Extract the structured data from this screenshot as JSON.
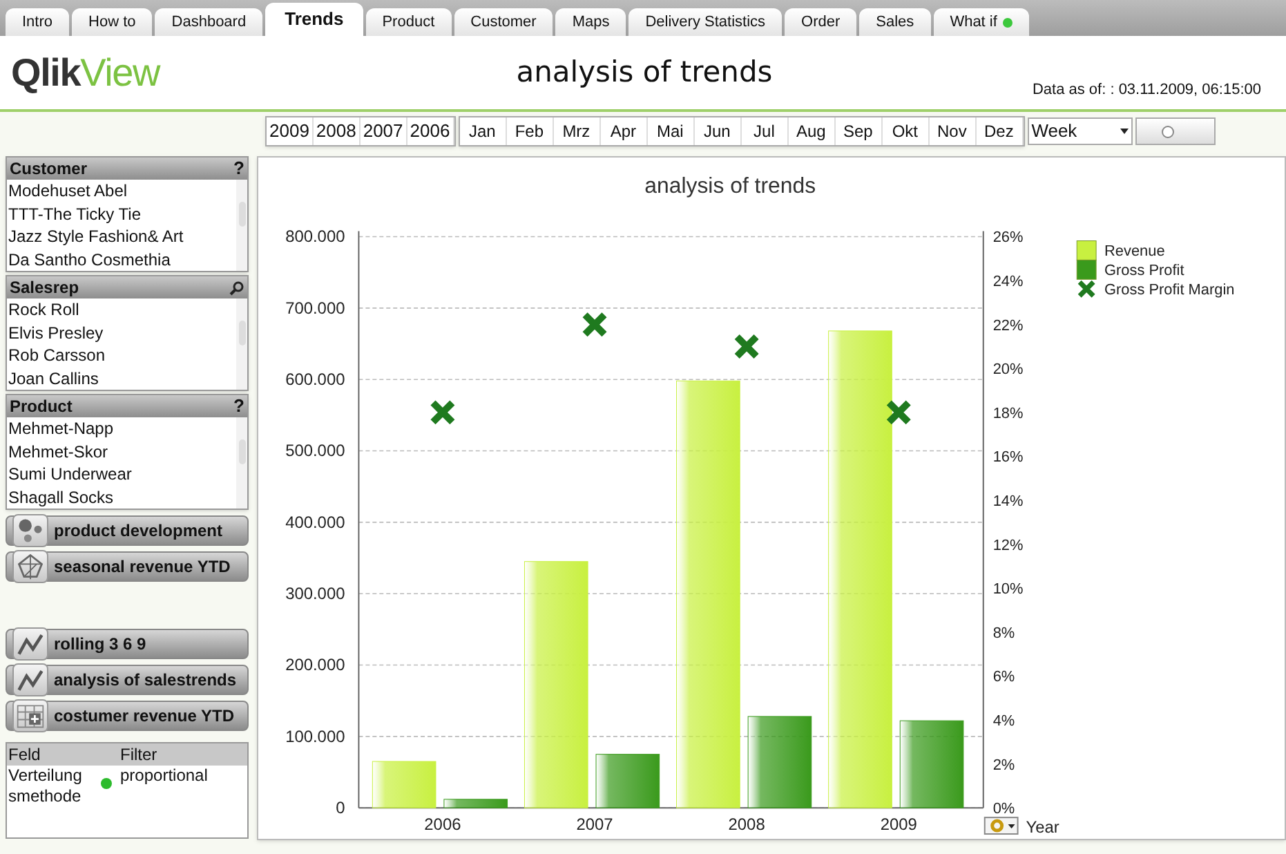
{
  "tabs": [
    {
      "label": "Intro",
      "selected": false
    },
    {
      "label": "How to",
      "selected": false
    },
    {
      "label": "Dashboard",
      "selected": false
    },
    {
      "label": "Trends",
      "selected": true
    },
    {
      "label": "Product",
      "selected": false
    },
    {
      "label": "Customer",
      "selected": false
    },
    {
      "label": "Maps",
      "selected": false
    },
    {
      "label": "Delivery Statistics",
      "selected": false
    },
    {
      "label": "Order",
      "selected": false
    },
    {
      "label": "Sales",
      "selected": false
    },
    {
      "label": "What if",
      "selected": false,
      "status_dot": true
    }
  ],
  "header": {
    "logo_left": "Qlik",
    "logo_right": "View",
    "title": "analysis of trends",
    "data_as_of": "Data as of: : 03.11.2009, 06:15:00"
  },
  "filters": {
    "years": [
      {
        "label": "2009",
        "selected": false
      },
      {
        "label": "2008",
        "selected": false
      },
      {
        "label": "2007",
        "selected": false
      },
      {
        "label": "2006",
        "selected": false
      }
    ],
    "months": [
      {
        "label": "Jan",
        "selected": false
      },
      {
        "label": "Feb",
        "selected": false
      },
      {
        "label": "Mrz",
        "selected": false
      },
      {
        "label": "Apr",
        "selected": false
      },
      {
        "label": "Mai",
        "selected": false
      },
      {
        "label": "Jun",
        "selected": false
      },
      {
        "label": "Jul",
        "selected": false
      },
      {
        "label": "Aug",
        "selected": false
      },
      {
        "label": "Sep",
        "selected": false
      },
      {
        "label": "Okt",
        "selected": false
      },
      {
        "label": "Nov",
        "selected": false
      },
      {
        "label": "Dez",
        "selected": false
      }
    ],
    "period": "Week",
    "slider": {
      "level": 0.4
    }
  },
  "listboxes": [
    {
      "title": "Customer",
      "kind": "help",
      "help": "?",
      "items": [
        {
          "label": "Modehuset Abel",
          "selected": false
        },
        {
          "label": "TTT-The Ticky Tie",
          "selected": false
        },
        {
          "label": "Jazz Style Fashion& Art",
          "selected": false
        },
        {
          "label": "Da Santho Cosmethia",
          "selected": false
        }
      ]
    },
    {
      "title": "Salesrep",
      "kind": "search",
      "items": [
        {
          "label": "Rock Roll",
          "selected": false
        },
        {
          "label": "Elvis Presley",
          "selected": false
        },
        {
          "label": "Rob Carsson",
          "selected": false
        },
        {
          "label": "Joan Callins",
          "selected": false
        }
      ]
    },
    {
      "title": "Product",
      "kind": "help",
      "help": "?",
      "items": [
        {
          "label": "Mehmet-Napp",
          "selected": false
        },
        {
          "label": "Mehmet-Skor",
          "selected": false
        },
        {
          "label": "Sumi Underwear",
          "selected": false
        },
        {
          "label": "Shagall Socks",
          "selected": false
        }
      ]
    }
  ],
  "nav_buttons": [
    {
      "label": "product development",
      "kind": "dots"
    },
    {
      "label": "seasonal revenue YTD",
      "kind": "radar"
    },
    {
      "label": "rolling 3 6 9",
      "kind": "line",
      "gap": true
    },
    {
      "label": "analysis of salestrends",
      "kind": "line"
    },
    {
      "label": "costumer revenue YTD",
      "kind": "table"
    }
  ],
  "filter_table": {
    "columns": [
      "Feld",
      "Filter"
    ],
    "rows": [
      {
        "field": "Verteilungsmethode",
        "filter": "proportional",
        "active": true
      }
    ]
  },
  "chart": {
    "chart_data": {
      "type": "bar",
      "stacked": false,
      "grid": true,
      "legend": "upper right",
      "title": "analysis of trends",
      "xlabel": "Year",
      "categories": [
        "2006",
        "2007",
        "2008",
        "2009"
      ],
      "series": [
        {
          "name": "Revenue",
          "color": "#c8f040",
          "values": [
            65000,
            345000,
            598000,
            668000
          ]
        },
        {
          "name": "Gross Profit",
          "color": "#3a9a1c",
          "values": [
            12000,
            75000,
            128000,
            122000
          ]
        },
        {
          "name": "Gross Profit Margin",
          "type": "scatter",
          "color": "#1f7a1f",
          "axis": "y2",
          "values": [
            0.18,
            0.22,
            0.21,
            0.18
          ]
        }
      ],
      "ylim": [
        0,
        800000
      ],
      "yticks": [
        {
          "value": 0,
          "label": "0"
        },
        {
          "value": 100000,
          "label": "100.000"
        },
        {
          "value": 200000,
          "label": "200.000"
        },
        {
          "value": 300000,
          "label": "300.000"
        },
        {
          "value": 400000,
          "label": "400.000"
        },
        {
          "value": 500000,
          "label": "500.000"
        },
        {
          "value": 600000,
          "label": "600.000"
        },
        {
          "value": 700000,
          "label": "700.000"
        },
        {
          "value": 800000,
          "label": "800.000"
        }
      ],
      "y2lim": [
        0,
        0.26
      ],
      "y2ticks": [
        {
          "value": 0,
          "label": "0%"
        },
        {
          "value": 0.02,
          "label": "2%"
        },
        {
          "value": 0.04,
          "label": "4%"
        },
        {
          "value": 0.06,
          "label": "6%"
        },
        {
          "value": 0.08,
          "label": "8%"
        },
        {
          "value": 0.1,
          "label": "10%"
        },
        {
          "value": 0.12,
          "label": "12%"
        },
        {
          "value": 0.14,
          "label": "14%"
        },
        {
          "value": 0.16,
          "label": "16%"
        },
        {
          "value": 0.18,
          "label": "18%"
        },
        {
          "value": 0.2,
          "label": "20%"
        },
        {
          "value": 0.22,
          "label": "22%"
        },
        {
          "value": 0.24,
          "label": "24%"
        },
        {
          "value": 0.26,
          "label": "26%"
        }
      ]
    }
  }
}
